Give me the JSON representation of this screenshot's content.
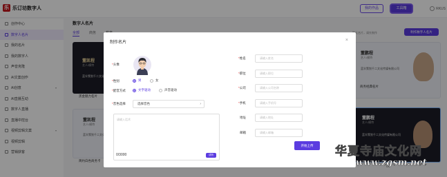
{
  "header": {
    "logo_mark": "乐",
    "logo_text": "乐订坊数字人",
    "btn_outline": "我的作品",
    "btn_solid": "工具箱",
    "user": "RKUS"
  },
  "sidebar": {
    "items": [
      {
        "label": "创作中心",
        "active": false,
        "caret": false
      },
      {
        "label": "数字人名片",
        "active": true,
        "caret": false
      },
      {
        "label": "我的名片",
        "active": false,
        "caret": false
      },
      {
        "label": "我的数字人",
        "active": false,
        "caret": false
      },
      {
        "label": "声音克隆",
        "active": false,
        "caret": false
      },
      {
        "label": "AI文案创作",
        "active": false,
        "caret": false
      },
      {
        "label": "AI创意",
        "active": false,
        "caret": true
      },
      {
        "label": "AI直播互动",
        "active": false,
        "caret": false
      },
      {
        "label": "数字人直播",
        "active": false,
        "caret": false
      },
      {
        "label": "直播中控台",
        "active": false,
        "caret": false
      },
      {
        "label": "视频剪辑文案",
        "active": false,
        "caret": true
      },
      {
        "label": "视频剪辑",
        "active": false,
        "caret": false
      },
      {
        "label": "营销获客",
        "active": false,
        "caret": false
      }
    ]
  },
  "main": {
    "title": "数字人名片",
    "tabs": [
      "全部",
      "商务",
      "教育"
    ],
    "hint": "暂无名片，请先制作",
    "make_button": "制作数字人名片",
    "left_cards": [
      {
        "name": "董凯程",
        "sub": "艺人/模特",
        "company": "蓝伞策划千二文化",
        "caption": "黑金魅力名片"
      },
      {
        "name": "董凯程",
        "sub": "艺人/模特",
        "company": "蓝伞策划千二文化",
        "caption": "简约白色商务卡"
      }
    ],
    "right_cards": [
      {
        "name": "董鹏程",
        "sub": "艺人/模特",
        "company": "蓝伞策划千二文化传媒有限公司",
        "caption": "商务经典名片"
      },
      {
        "name": "董鹏程",
        "sub": "艺人/模特",
        "company": "蓝伞策划千二文化传媒有限公司",
        "caption": "商务经典名片"
      }
    ]
  },
  "modal": {
    "title": "制作名片",
    "close": "×",
    "avatar_label": "头像",
    "gender_label": "性别",
    "gender_options": [
      "男",
      "女"
    ],
    "gender_selected": "男",
    "config_label": "配音方式",
    "config_options": [
      "文字驱动",
      "声音驱动"
    ],
    "config_selected": "文字驱动",
    "voice_label": "音色选择",
    "voice_value": "选择音色",
    "textarea_placeholder": "请输入话术",
    "textarea_count": "0/3000",
    "textarea_button": "试听",
    "fields": [
      {
        "label": "姓名",
        "required": true,
        "placeholder": "请输入姓名"
      },
      {
        "label": "职位",
        "required": true,
        "placeholder": "请输入职位"
      },
      {
        "label": "公司",
        "required": true,
        "placeholder": "请输入公司名称"
      },
      {
        "label": "手机",
        "required": true,
        "placeholder": "请输入手机号"
      },
      {
        "label": "地址",
        "required": false,
        "placeholder": "请输入地址"
      },
      {
        "label": "邮箱",
        "required": false,
        "placeholder": "请输入邮箱"
      }
    ],
    "submit": "开始上传"
  },
  "watermark": {
    "cn": "华夏寺庙文化网",
    "url": "www.zgsm.net"
  },
  "colors": {
    "accent": "#5b3ce0",
    "brand_red": "#c4161c",
    "overlay": "rgba(0,0,0,0.42)"
  }
}
